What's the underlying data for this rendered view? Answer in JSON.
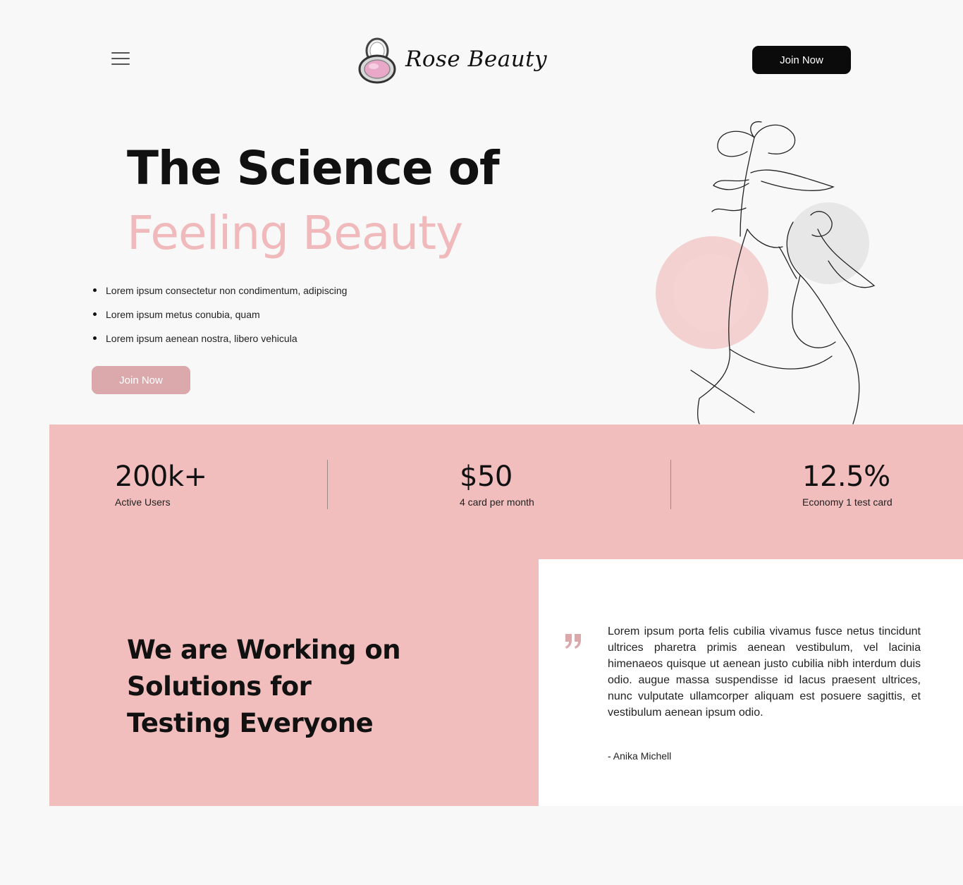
{
  "header": {
    "brand": "Rose Beauty",
    "menu_icon": "hamburger-menu-icon",
    "logo_icon": "compact-mirror-logo-icon",
    "cta_label": "Join Now"
  },
  "hero": {
    "title": "The Science of",
    "title_accent": "Feeling Beauty",
    "bullets": [
      "Lorem ipsum consectetur non condimentum, adipiscing",
      "Lorem ipsum metus conubia, quam",
      "Lorem ipsum aenean nostra, libero vehicula"
    ],
    "cta_label": "Join Now",
    "illustration": "line-art-woman-with-flowers-illustration"
  },
  "stats": [
    {
      "value": "200k+",
      "label": "Active Users"
    },
    {
      "value": "$50",
      "label": "4 card per month"
    },
    {
      "value": "12.5%",
      "label": "Economy 1 test card"
    }
  ],
  "mission": {
    "title": "We are Working on Solutions for Testing Everyone"
  },
  "testimonial": {
    "quote_icon": "quote-mark-icon",
    "text": "Lorem ipsum porta felis cubilia vivamus fusce netus tincidunt ultrices pharetra primis aenean vestibulum, vel lacinia himenaeos quisque ut aenean justo cubilia nibh interdum duis odio. augue massa suspendisse id lacus praesent ultrices, nunc vulputate ullamcorper aliquam est posuere sagittis, et vestibulum aenean ipsum odio.",
    "author": "- Anika Michell"
  },
  "colors": {
    "background": "#f8f8f8",
    "accent_pink": "#f1bdbd",
    "accent_text": "#f0b9bb",
    "button_pink": "#dba8ab",
    "button_dark": "#0b0b0b",
    "panel_white": "#ffffff"
  }
}
